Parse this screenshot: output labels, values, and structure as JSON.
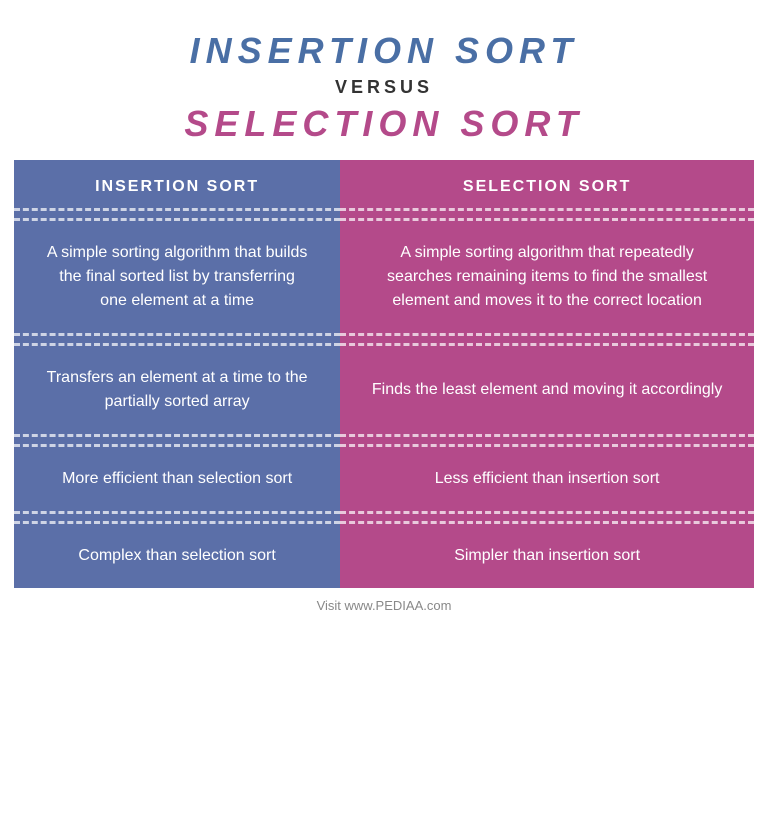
{
  "header": {
    "title_insertion": "INSERTION SORT",
    "versus": "VERSUS",
    "title_selection": "SELECTION SORT"
  },
  "table": {
    "col1_header": "INSERTION SORT",
    "col2_header": "SELECTION SORT",
    "rows": [
      {
        "insertion": "A simple sorting algorithm that builds the final sorted list by transferring one element at a time",
        "selection": "A simple sorting algorithm that repeatedly searches remaining items to find the smallest element and moves it to the correct location"
      },
      {
        "insertion": "Transfers an element at a time to the partially sorted array",
        "selection": "Finds the least element and moving it accordingly"
      },
      {
        "insertion": "More efficient than selection sort",
        "selection": "Less efficient than insertion sort"
      },
      {
        "insertion": "Complex than selection sort",
        "selection": "Simpler than insertion sort"
      }
    ],
    "footer": "Visit www.PEDIAA.com"
  },
  "colors": {
    "insertion_bg": "#5b6fa8",
    "selection_bg": "#b44a8a",
    "insertion_title": "#4a6fa5",
    "selection_title": "#b44a8a"
  }
}
